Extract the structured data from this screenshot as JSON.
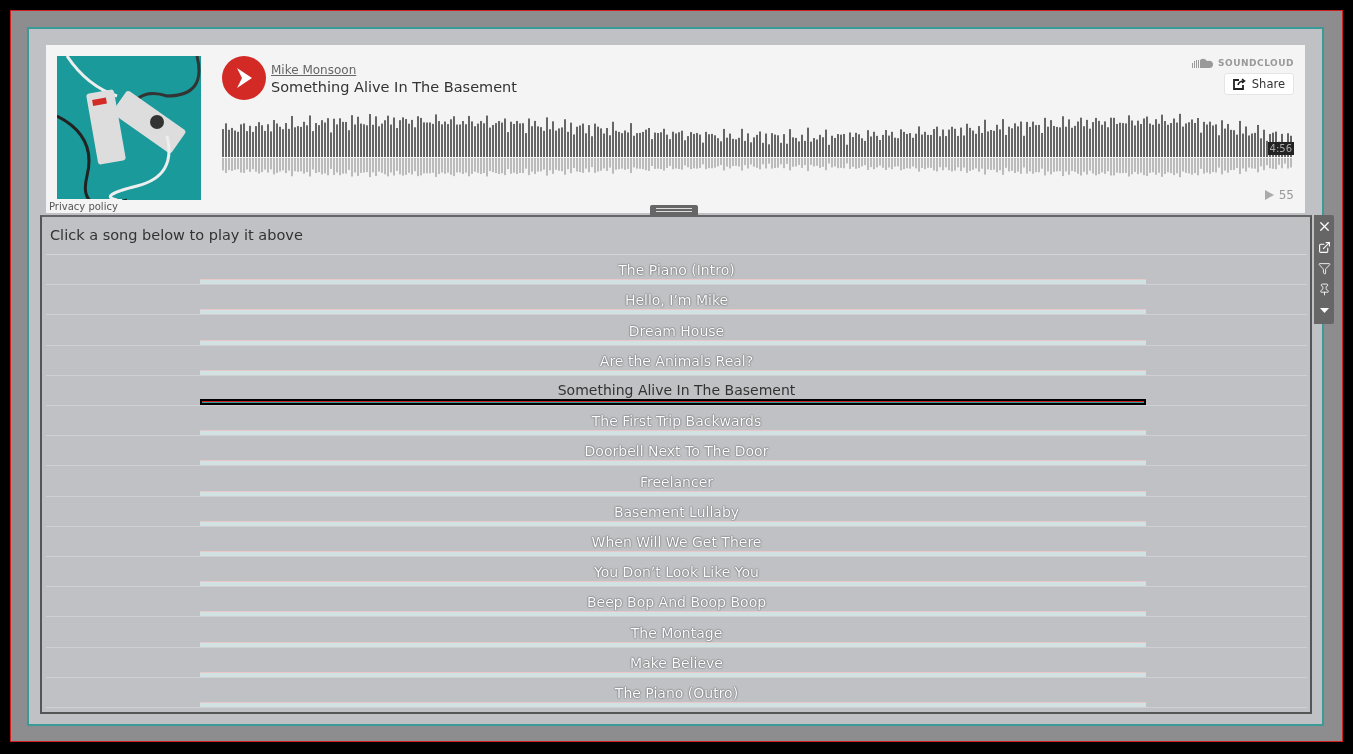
{
  "player": {
    "artist": "Mike Monsoon",
    "title": "Something Alive In The Basement",
    "brand": "SOUNDCLOUD",
    "share_label": "Share",
    "duration": "4:56",
    "play_count": "55",
    "privacy": "Privacy policy"
  },
  "panel": {
    "title": "Click a song below to play it above",
    "songs": [
      {
        "title": "The Piano (Intro)",
        "selected": false
      },
      {
        "title": "Hello, I’m Mike",
        "selected": false
      },
      {
        "title": "Dream House",
        "selected": false
      },
      {
        "title": "Are the Animals Real?",
        "selected": false
      },
      {
        "title": "Something Alive In The Basement",
        "selected": true
      },
      {
        "title": "The First Trip Backwards",
        "selected": false
      },
      {
        "title": "Doorbell Next To The Door",
        "selected": false
      },
      {
        "title": "Freelancer",
        "selected": false
      },
      {
        "title": "Basement Lullaby",
        "selected": false
      },
      {
        "title": "When Will We Get There",
        "selected": false
      },
      {
        "title": "You Don’t Look Like You",
        "selected": false
      },
      {
        "title": "Beep Bop And Boop Boop",
        "selected": false
      },
      {
        "title": "The Montage",
        "selected": false
      },
      {
        "title": "Make Believe",
        "selected": false
      },
      {
        "title": "The Piano (Outro)",
        "selected": false
      }
    ]
  }
}
